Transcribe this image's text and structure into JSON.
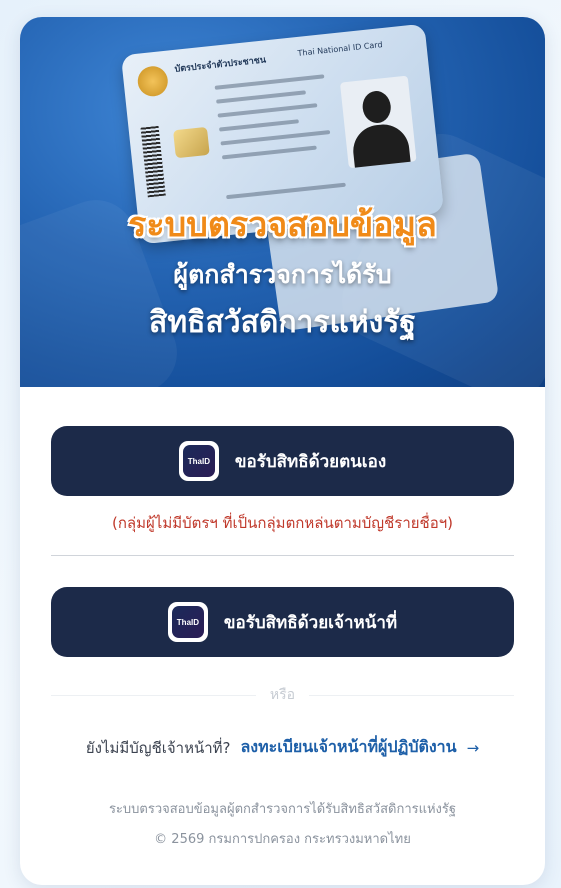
{
  "banner": {
    "card_title_th": "บัตรประจำตัวประชาชน",
    "card_title_en": "Thai National ID Card",
    "headline": "ระบบตรวจสอบข้อมูล",
    "subline1": "ผู้ตกสำรวจการได้รับ",
    "subline2": "สิทธิสวัสดิการแห่งรัฐ"
  },
  "actions": {
    "self_button_label": "ขอรับสิทธิด้วยตนเอง",
    "self_note": "(กลุ่มผู้ไม่มีบัตรฯ ที่เป็นกลุ่มตกหล่นตามบัญชีรายชื่อฯ)",
    "staff_button_label": "ขอรับสิทธิด้วยเจ้าหน้าที่",
    "logo_text": "ThaID",
    "or_text": "หรือ"
  },
  "register": {
    "question": "ยังไม่มีบัญชีเจ้าหน้าที่?",
    "link_label": "ลงทะเบียนเจ้าหน้าที่ผู้ปฏิบัติงาน",
    "arrow": "→"
  },
  "footer": {
    "line1": "ระบบตรวจสอบข้อมูลผู้ตกสำรวจการได้รับสิทธิสวัสดิการแห่งรัฐ",
    "line2": "© 2569 กรมการปกครอง กระทรวงมหาดไทย"
  },
  "colors": {
    "button_bg": "#1c2a49",
    "note_red": "#c0392b",
    "link_blue": "#1d5fa8",
    "headline_orange": "#f08a18"
  }
}
